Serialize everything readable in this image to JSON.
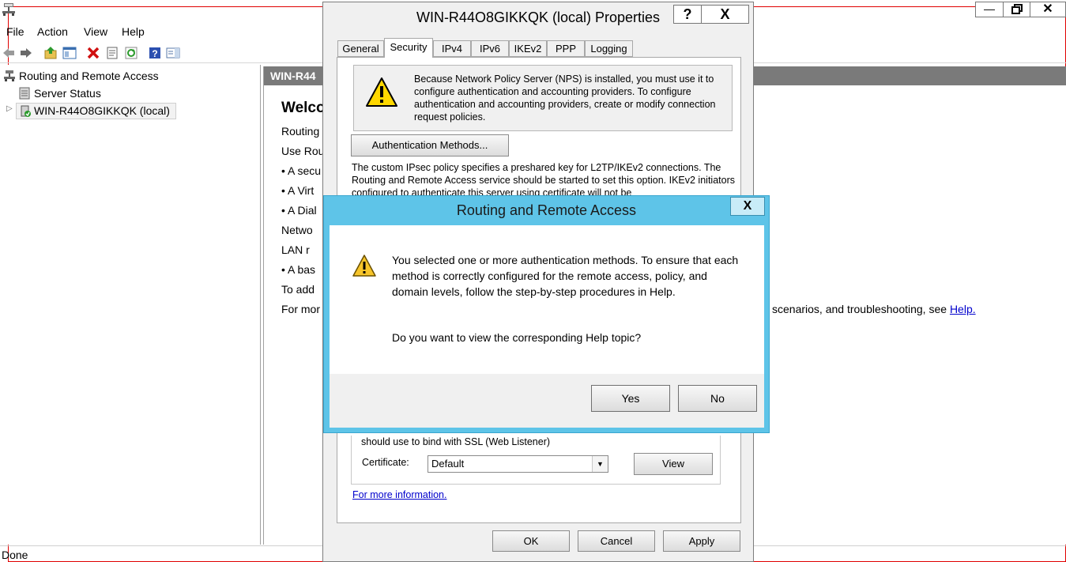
{
  "app": {
    "menu": [
      "File",
      "Action",
      "View",
      "Help"
    ],
    "status": "Done"
  },
  "tree": {
    "root": "Routing and Remote Access",
    "items": [
      "Server Status",
      "WIN-R44O8GIKKQK (local)"
    ]
  },
  "right_pane": {
    "header": "WIN-R44",
    "title": "Welco",
    "lines": [
      "Routing",
      "Use Rou",
      "• A secu",
      "• A Virt",
      "• A Dial",
      "Netwo",
      "LAN r",
      "• A bas",
      "To add",
      "For mor"
    ],
    "trailing_text": "scenarios, and troubleshooting, see ",
    "help_link": "Help."
  },
  "properties": {
    "title": "WIN-R44O8GIKKQK (local) Properties",
    "help_btn": "?",
    "close_btn": "X",
    "tabs": [
      "General",
      "Security",
      "IPv4",
      "IPv6",
      "IKEv2",
      "PPP",
      "Logging"
    ],
    "active_tab": "Security",
    "nps_notice": "Because Network Policy Server (NPS) is installed, you must use it to configure authentication and accounting providers. To configure authentication and accounting providers, create or modify connection request policies.",
    "auth_methods_btn": "Authentication Methods...",
    "ipsec_text": "The custom IPsec policy specifies a preshared key for L2TP/IKEv2 connections. The Routing and Remote Access service should be started to set this option. IKEv2 initiators configured to authenticate this server using certificate will not be",
    "ssl_text": "should use to bind with SSL (Web Listener)",
    "certificate_label": "Certificate:",
    "certificate_value": "Default",
    "view_btn": "View",
    "more_info_link": "For more information.",
    "ok_btn": "OK",
    "cancel_btn": "Cancel",
    "apply_btn": "Apply"
  },
  "msgbox": {
    "title": "Routing and Remote Access",
    "close_btn": "X",
    "message": "You selected one or more authentication methods. To ensure that each method is correctly configured for the remote access, policy, and domain levels, follow the step-by-step procedures in Help.",
    "question": "Do you want to view the corresponding Help topic?",
    "yes_btn": "Yes",
    "no_btn": "No"
  },
  "colors": {
    "msgbox_frame": "#5ec4e8",
    "header_bar": "#7a7a7a",
    "link": "#0000cc",
    "warning": "#ffd700"
  }
}
